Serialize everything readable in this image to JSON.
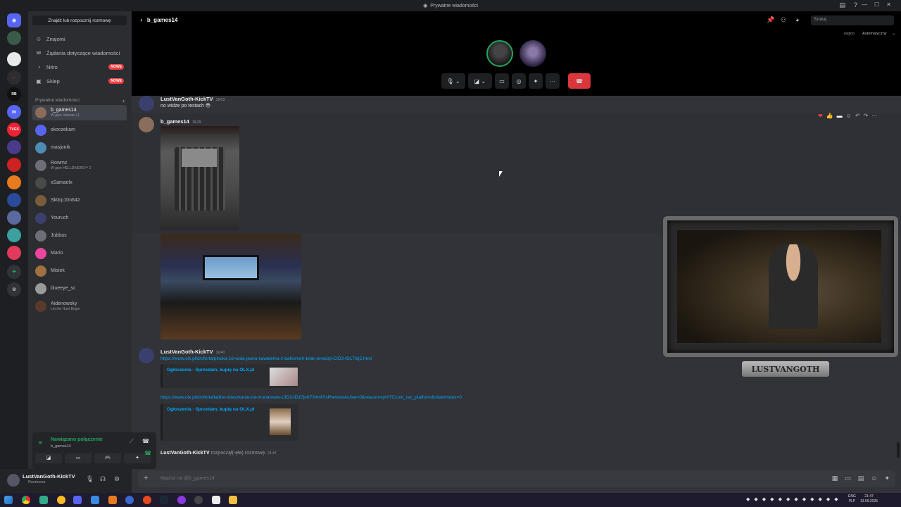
{
  "window": {
    "title": "Prywatne wiadomości"
  },
  "sidebar": {
    "find_button": "Znajdź lub rozpocznij rozmowę",
    "nav": [
      {
        "label": "Znajomi",
        "icon": "friends-icon"
      },
      {
        "label": "Żądania dotyczące wiadomości",
        "icon": "mail-icon"
      },
      {
        "label": "Nitro",
        "icon": "nitro-icon",
        "badge": "NOWE"
      },
      {
        "label": "Sklep",
        "icon": "shop-icon",
        "badge": "NOWE"
      }
    ],
    "dm_header": "Prywatne wiadomości",
    "dm_add": "+",
    "dms": [
      {
        "name": "b_games14",
        "sub": "W grze Volanta +1",
        "active": true,
        "color": "#8a6d5a"
      },
      {
        "name": "skoczekam",
        "sub": "",
        "color": "#5865f2"
      },
      {
        "name": "masjonik",
        "sub": "",
        "color": "#4e8cb6"
      },
      {
        "name": "Rowmz",
        "sub": "W grze HELLDIVERS™ 2",
        "color": "#6d6f78"
      },
      {
        "name": "xSamaelx",
        "sub": "",
        "color": "#4a4a4a"
      },
      {
        "name": "Sk0rp10n642",
        "sub": "",
        "color": "#7a5c3a"
      },
      {
        "name": "Youruch",
        "sub": "",
        "color": "#3b3f6e"
      },
      {
        "name": "Jubbas",
        "sub": "",
        "color": "#6d6f78"
      },
      {
        "name": "Mario",
        "sub": "",
        "color": "#eb459e"
      },
      {
        "name": "Misiek",
        "sub": "",
        "color": "#a07040"
      },
      {
        "name": "blueeye_sc",
        "sub": "",
        "color": "#9a9a9a"
      },
      {
        "name": "Aidenowsky",
        "sub": "Let the Hunt Begin",
        "color": "#5a3a2a"
      }
    ],
    "voice": {
      "status": "Nawiązano połączenie",
      "channel": "b_games14"
    },
    "user": {
      "name": "LustVanGoth-KickTV",
      "status": "Rozmowa"
    }
  },
  "call": {
    "dm_title": "b_games14",
    "search_placeholder": "Szukaj",
    "region_label": "region",
    "region_value": "Automatyczny"
  },
  "messages": [
    {
      "author": "LustVanGoth-KickTV",
      "time": "19:03",
      "text": "no widze po testach 😳"
    },
    {
      "author": "b_games14",
      "time": "19:29"
    },
    {
      "author": "LustVanGoth-KickTV",
      "time": "19:40",
      "link1": "https://www.olx.pl/d/oferta/plocka-16-wola-jasna-kawalerka-z-balkonem-brak-prowizji-CID3-ID17ktj5.html",
      "embed1": "Ogłoszenia - Sprzedam, kupię na OLX.pl",
      "link2": "https://www.olx.pl/d/oferta/ladne-mieszkanie-na-muranowie-CID3-ID17joKF.html?isPreviewActive=0&reason=ip%7Ccool_rec_platform&sliderIndex=0",
      "embed2": "Ogłoszenia - Sprzedam, kupię na OLX.pl"
    }
  ],
  "system": {
    "author": "LustVanGoth-KickTV",
    "text": "rozpoczął(-ęła) rozmowę.",
    "time": "21:47"
  },
  "composer": {
    "placeholder": "Napisz na @b_games14"
  },
  "stream": {
    "label": "LUSTVANGOTH"
  },
  "taskbar": {
    "lang1": "ENG",
    "lang2": "PLP",
    "time": "21:47",
    "date": "13.09.2025"
  }
}
